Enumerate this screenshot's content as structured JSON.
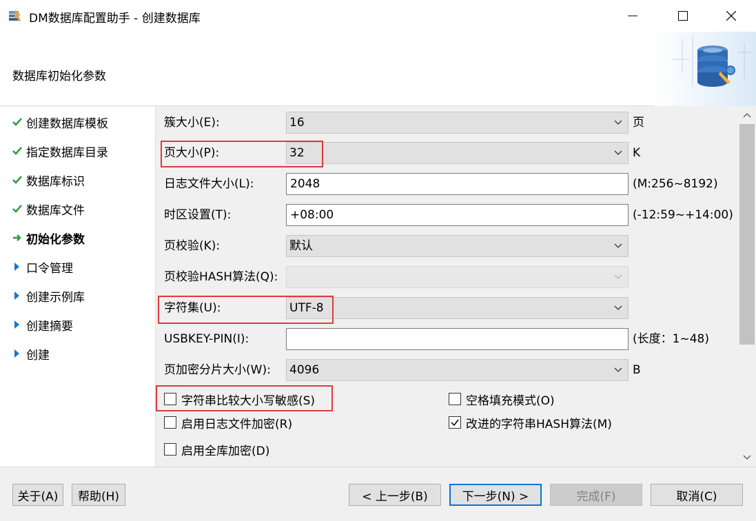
{
  "window": {
    "title": "DM数据库配置助手 - 创建数据库",
    "app_icon": "database-wizard-icon"
  },
  "header": {
    "title": "数据库初始化参数",
    "logo_icon": "database-gear-icon"
  },
  "sidebar": {
    "items": [
      {
        "label": "创建数据库模板",
        "state": "done",
        "icon": "check-icon"
      },
      {
        "label": "指定数据库目录",
        "state": "done",
        "icon": "check-icon"
      },
      {
        "label": "数据库标识",
        "state": "done",
        "icon": "check-icon"
      },
      {
        "label": "数据库文件",
        "state": "done",
        "icon": "check-icon"
      },
      {
        "label": "初始化参数",
        "state": "current",
        "icon": "arrow-right-icon"
      },
      {
        "label": "口令管理",
        "state": "pending",
        "icon": "triangle-right-icon"
      },
      {
        "label": "创建示例库",
        "state": "pending",
        "icon": "triangle-right-icon"
      },
      {
        "label": "创建摘要",
        "state": "pending",
        "icon": "triangle-right-icon"
      },
      {
        "label": "创建",
        "state": "pending",
        "icon": "triangle-right-icon"
      }
    ]
  },
  "form": {
    "extent_size": {
      "label": "簇大小(E):",
      "value": "16",
      "unit": "页"
    },
    "page_size": {
      "label": "页大小(P):",
      "value": "32",
      "unit": "K"
    },
    "log_size": {
      "label": "日志文件大小(L):",
      "value": "2048",
      "unit": "(M:256~8192)"
    },
    "time_zone": {
      "label": "时区设置(T):",
      "value": "+08:00",
      "unit": "(-12:59~+14:00)"
    },
    "page_check": {
      "label": "页校验(K):",
      "value": "默认"
    },
    "page_check_hash": {
      "label": "页校验HASH算法(Q):",
      "value": ""
    },
    "charset": {
      "label": "字符集(U):",
      "value": "UTF-8"
    },
    "usbkey_pin": {
      "label": "USBKEY-PIN(I):",
      "value": "",
      "unit": "(长度：1~48)"
    },
    "page_enc_slice": {
      "label": "页加密分片大小(W):",
      "value": "4096",
      "unit": "B"
    },
    "case_sensitive": {
      "label": "字符串比较大小写敏感(S)",
      "checked": false
    },
    "blank_pad": {
      "label": "空格填充模式(O)",
      "checked": false
    },
    "log_encrypt": {
      "label": "启用日志文件加密(R)",
      "checked": false
    },
    "improved_hash": {
      "label": "改进的字符串HASH算法(M)",
      "checked": true
    },
    "full_encrypt": {
      "label": "启用全库加密(D)",
      "checked": false
    }
  },
  "footer": {
    "about": "关于(A)",
    "help": "帮助(H)",
    "prev": "< 上一步(B)",
    "next": "下一步(N) >",
    "finish": "完成(F)",
    "cancel": "取消(C)"
  },
  "colors": {
    "highlight": "#e0393e",
    "check_green": "#2e9c3c",
    "nav_arrow_blue": "#1a73c9",
    "primary_border": "#0078d7"
  }
}
